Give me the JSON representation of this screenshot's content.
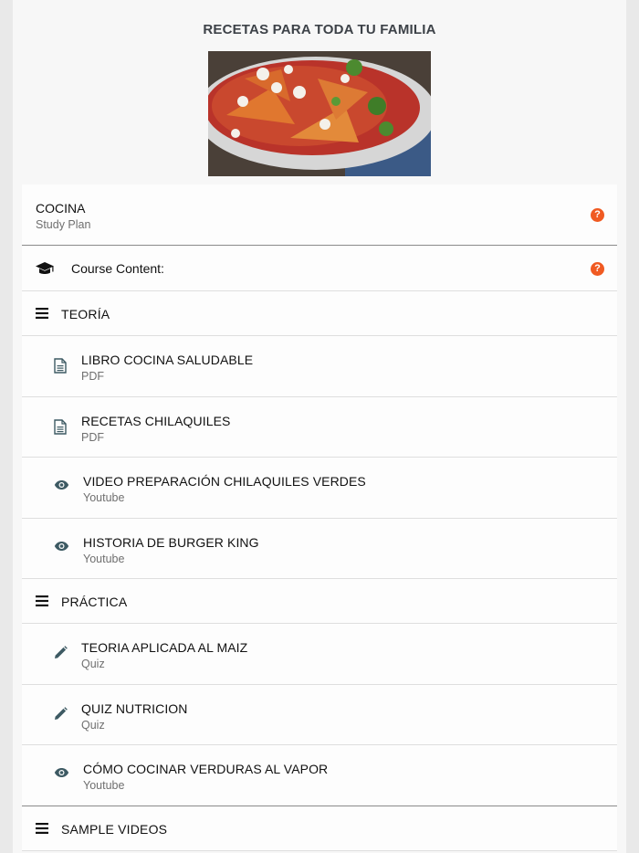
{
  "header": {
    "title": "RECETAS PARA TODA TU FAMILIA"
  },
  "hero": {
    "icon": "food-photo-icon"
  },
  "plan": {
    "title": "COCINA",
    "subtitle": "Study Plan",
    "help": "?"
  },
  "course": {
    "label": "Course Content:",
    "help": "?",
    "icon": "graduation-cap-icon"
  },
  "sections": [
    {
      "label": "TEORÍA",
      "items": [
        {
          "title": "LIBRO COCINA SALUDABLE",
          "type": "PDF",
          "icon": "document-icon"
        },
        {
          "title": "RECETAS CHILAQUILES",
          "type": "PDF",
          "icon": "document-icon"
        },
        {
          "title": "VIDEO PREPARACIÓN CHILAQUILES VERDES",
          "type": "Youtube",
          "icon": "eye-icon"
        },
        {
          "title": "HISTORIA DE BURGER KING",
          "type": "Youtube",
          "icon": "eye-icon"
        }
      ]
    },
    {
      "label": "PRÁCTICA",
      "items": [
        {
          "title": "TEORIA APLICADA AL MAIZ",
          "type": "Quiz",
          "icon": "pencil-icon"
        },
        {
          "title": "QUIZ NUTRICION",
          "type": "Quiz",
          "icon": "pencil-icon"
        },
        {
          "title": "CÓMO COCINAR VERDURAS AL VAPOR",
          "type": "Youtube",
          "icon": "eye-icon"
        }
      ]
    },
    {
      "label": "SAMPLE VIDEOS",
      "items": []
    }
  ],
  "colors": {
    "accent": "#f05a22",
    "icon": "#3d5a63",
    "subtext": "#6f6f6f"
  }
}
